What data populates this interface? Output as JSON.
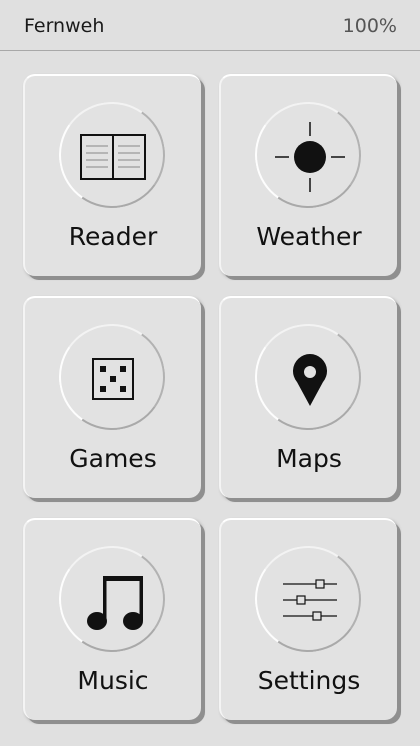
{
  "status_bar": {
    "app_name": "Fernweh",
    "battery": "100%"
  },
  "tiles": [
    {
      "label": "Reader",
      "icon": "book-icon"
    },
    {
      "label": "Weather",
      "icon": "sun-icon"
    },
    {
      "label": "Games",
      "icon": "dice-icon"
    },
    {
      "label": "Maps",
      "icon": "map-pin-icon"
    },
    {
      "label": "Music",
      "icon": "music-note-icon"
    },
    {
      "label": "Settings",
      "icon": "sliders-icon"
    }
  ]
}
